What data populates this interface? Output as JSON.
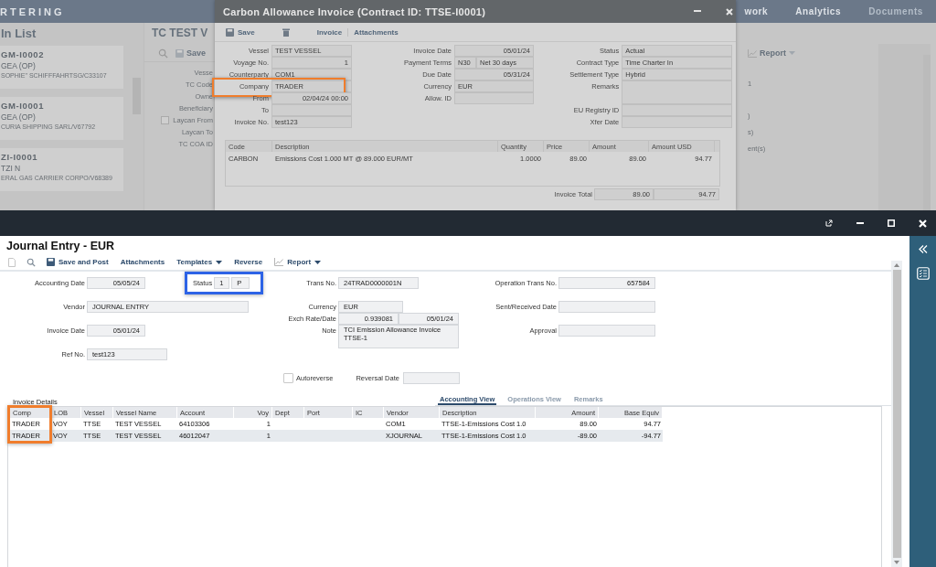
{
  "background_app": {
    "brand": "RTERING",
    "nav": [
      {
        "label": "work",
        "disabled": false
      },
      {
        "label": "Analytics",
        "disabled": false
      },
      {
        "label": "Documents",
        "disabled": true
      }
    ],
    "list_title": "In List",
    "cards": [
      {
        "code": "GM-I0002",
        "name": "GEA (OP)",
        "owner": "SOPHIE\" SCHIFFFAHRTSG/C33107"
      },
      {
        "code": "GM-I0001",
        "name": "GEA (OP)",
        "owner": "CURIA SHIPPING SARL/V67792"
      },
      {
        "code": "ZI-I0001",
        "name": "TZI N",
        "owner": "ERAL GAS CARRIER CORPO/V68389"
      }
    ],
    "detail_title": "TC TEST V",
    "save": "Save",
    "report": "Report",
    "labels": [
      {
        "label": "Vesse",
        "kind": "text"
      },
      {
        "label": "TC Code",
        "kind": "text"
      },
      {
        "label": "Owne",
        "kind": "text"
      },
      {
        "label": "Beneficiary",
        "kind": "text"
      },
      {
        "label": "Laycan From",
        "kind": "check",
        "checked": false
      },
      {
        "label": "Laycan To",
        "kind": "text"
      },
      {
        "label": "TC COA ID",
        "kind": "text"
      }
    ],
    "fragments": [
      "1",
      ")",
      "s)",
      "ent(s)"
    ]
  },
  "invoice_modal": {
    "title": "Carbon Allowance Invoice (Contract ID: TTSE-I0001)",
    "toolbar": [
      {
        "kind": "save",
        "label": "Save"
      },
      {
        "kind": "delete"
      },
      {
        "kind": "text",
        "label": "Invoice"
      },
      {
        "kind": "text",
        "label": "Attachments"
      }
    ],
    "fields_left": [
      {
        "label": "Vessel",
        "values": [
          "TEST VESSEL"
        ],
        "kind": "text",
        "highlighted": false
      },
      {
        "label": "Voyage No.",
        "values": [
          "1"
        ],
        "kind": "number",
        "highlighted": false
      },
      {
        "label": "Counterparty",
        "values": [
          "COM1"
        ],
        "kind": "text",
        "highlighted": false
      },
      {
        "label": "Company",
        "values": [
          "TRADER"
        ],
        "kind": "text",
        "highlighted": true
      },
      {
        "label": "From",
        "values": [
          "02/04/24 00:00"
        ],
        "kind": "number",
        "highlighted": false
      },
      {
        "label": "To",
        "kind": "text",
        "highlighted": false
      },
      {
        "label": "Invoice No.",
        "values": [
          "test123"
        ],
        "kind": "text",
        "highlighted": false
      }
    ],
    "fields_middle": [
      {
        "label": "Invoice Date",
        "values": [
          "05/01/24"
        ],
        "kind": "number",
        "highlighted": false
      },
      {
        "label": "Payment Terms",
        "values": [
          "N30",
          "Net 30 days"
        ],
        "kind": "pair",
        "highlighted": false
      },
      {
        "label": "Due Date",
        "values": [
          "05/31/24"
        ],
        "kind": "number",
        "highlighted": false
      },
      {
        "label": "Currency",
        "values": [
          "EUR"
        ],
        "kind": "text",
        "highlighted": false
      },
      {
        "label": "Allow. ID",
        "kind": "text",
        "highlighted": false
      }
    ],
    "fields_right": [
      {
        "label": "Status",
        "values": [
          "Actual"
        ],
        "kind": "text",
        "highlighted": false
      },
      {
        "label": "Contract Type",
        "values": [
          "Time Charter In"
        ],
        "kind": "text",
        "highlighted": false
      },
      {
        "label": "Settlement Type",
        "values": [
          "Hybrid"
        ],
        "kind": "text",
        "highlighted": false
      },
      {
        "label": "Remarks",
        "kind": "area",
        "highlighted": false
      },
      {
        "label": "EU Registry ID",
        "kind": "text",
        "highlighted": false
      },
      {
        "label": "Xfer Date",
        "kind": "text",
        "highlighted": false
      }
    ],
    "table": {
      "columns": [
        {
          "label": "Code",
          "numeric": false
        },
        {
          "label": "Description",
          "numeric": false
        },
        {
          "label": "Quantity",
          "numeric": true
        },
        {
          "label": "Price",
          "numeric": true
        },
        {
          "label": "Amount",
          "numeric": true
        },
        {
          "label": "Amount USD",
          "numeric": true
        }
      ],
      "rows": [
        [
          "CARBON",
          "Emissions Cost 1.000 MT @ 89.000 EUR/MT",
          "1.0000",
          "89.00",
          "89.00",
          "94.77"
        ]
      ],
      "total_label": "Invoice Total",
      "totals": [
        "89.00",
        "94.77"
      ]
    }
  },
  "journal": {
    "title": "Journal Entry - EUR",
    "toolbar": [
      {
        "kind": "new"
      },
      {
        "kind": "search"
      },
      {
        "kind": "save",
        "label": "Save and Post"
      },
      {
        "kind": "text",
        "label": "Attachments"
      },
      {
        "kind": "menu",
        "label": "Templates"
      },
      {
        "kind": "text",
        "label": "Reverse"
      },
      {
        "kind": "report",
        "label": "Report"
      }
    ],
    "form": {
      "accounting_date": {
        "label": "Accounting Date",
        "values": [
          "05/05/24"
        ]
      },
      "status": {
        "label": "Status",
        "values": [
          "1",
          "P"
        ],
        "highlighted": true
      },
      "trans_no": {
        "label": "Trans No.",
        "values": [
          "24TRAD0000001N"
        ]
      },
      "operation_trans_no": {
        "label": "Operation Trans No.",
        "values": [
          "657584"
        ]
      },
      "vendor": {
        "label": "Vendor",
        "values": [
          "JOURNAL ENTRY"
        ]
      },
      "currency": {
        "label": "Currency",
        "values": [
          "EUR"
        ]
      },
      "sent_received_date": {
        "label": "Sent/Received Date"
      },
      "exch_rate_date": {
        "label": "Exch Rate/Date",
        "values": [
          "0.939081",
          "05/01/24"
        ]
      },
      "note": {
        "label": "Note",
        "values": [
          "TCI Emission Allowance Invoice TTSE-1"
        ]
      },
      "invoice_date": {
        "label": "Invoice Date",
        "values": [
          "05/01/24"
        ]
      },
      "approval": {
        "label": "Approval"
      },
      "ref_no": {
        "label": "Ref No.",
        "values": [
          "test123"
        ]
      },
      "autoreverse": {
        "label": "Autoreverse",
        "checked": false
      },
      "reversal_date": {
        "label": "Reversal Date"
      }
    },
    "section_title": "Invoice Details",
    "tabs": [
      {
        "label": "Accounting View",
        "selected": true
      },
      {
        "label": "Operations View",
        "selected": false
      },
      {
        "label": "Remarks",
        "selected": false
      }
    ],
    "table": {
      "columns": [
        {
          "label": "Comp",
          "numeric": false,
          "highlighted": true
        },
        {
          "label": "LOB",
          "numeric": false,
          "highlighted": false
        },
        {
          "label": "Vessel",
          "numeric": false,
          "highlighted": false
        },
        {
          "label": "Vessel Name",
          "numeric": false,
          "highlighted": false
        },
        {
          "label": "Account",
          "numeric": false,
          "highlighted": false
        },
        {
          "label": "Voy",
          "numeric": true,
          "highlighted": false
        },
        {
          "label": "Dept",
          "numeric": false,
          "highlighted": false
        },
        {
          "label": "Port",
          "numeric": false,
          "highlighted": false
        },
        {
          "label": "IC",
          "numeric": false,
          "highlighted": false
        },
        {
          "label": "Vendor",
          "numeric": false,
          "highlighted": false
        },
        {
          "label": "Description",
          "numeric": false,
          "highlighted": false
        },
        {
          "label": "Amount",
          "numeric": true,
          "highlighted": false
        },
        {
          "label": "Base Equiv",
          "numeric": true,
          "highlighted": false
        }
      ],
      "rows": [
        [
          "TRADER",
          "VOY",
          "TTSE",
          "TEST VESSEL",
          "64103306",
          "1",
          null,
          null,
          null,
          "COM1",
          "TTSE-1-Emissions Cost 1.0",
          "89.00",
          "94.77"
        ],
        [
          "TRADER",
          "VOY",
          "TTSE",
          "TEST VESSEL",
          "46012047",
          "1",
          null,
          null,
          null,
          "XJOURNAL",
          "TTSE-1-Emissions Cost 1.0",
          "-89.00",
          "-94.77"
        ]
      ]
    }
  }
}
